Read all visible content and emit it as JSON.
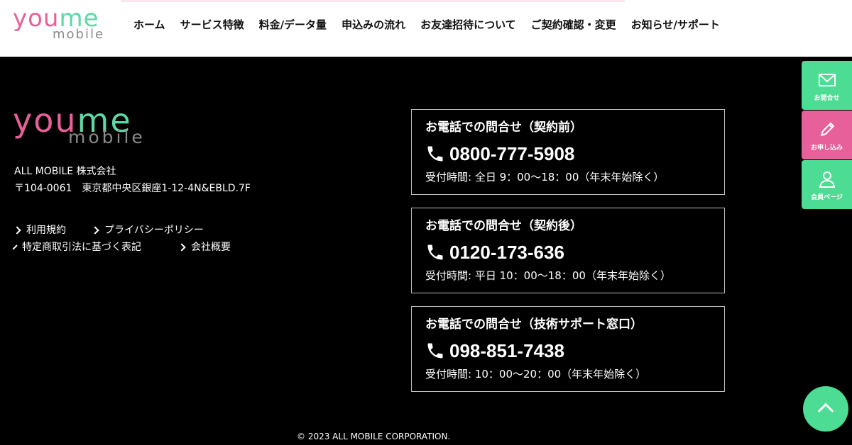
{
  "header": {
    "logo": {
      "you": "you",
      "me": "me",
      "mobile": "mobile"
    },
    "nav": [
      "ホーム",
      "サービス特徴",
      "料金/データ量",
      "申込みの流れ",
      "お友達招待について",
      "ご契約確認・変更",
      "お知らせ/サポート"
    ]
  },
  "footer": {
    "logo": {
      "you": "you",
      "me": "me",
      "mobile": "mobile"
    },
    "company_name": "ALL MOBILE 株式会社",
    "address": "〒104-0061　東京都中央区銀座1-12-4N&EBLD.7F",
    "links": [
      "利用規約",
      "プライバシーポリシー",
      "特定商取引法に基づく表記",
      "会社概要"
    ],
    "copyright": "© 2023 ALL MOBILE CORPORATION."
  },
  "contacts": [
    {
      "title": "お電話での問合せ（契約前）",
      "phone": "0800-777-5908",
      "hours": "受付時間: 全日 9：00〜18：00（年末年始除く）"
    },
    {
      "title": "お電話での問合せ（契約後）",
      "phone": "0120-173-636",
      "hours": "受付時間: 平日 10：00〜18：00（年末年始除く）"
    },
    {
      "title": "お電話での問合せ（技術サポート窓口）",
      "phone": "098-851-7438",
      "hours": "受付時間: 10：00〜20：00（年末年始除く）"
    }
  ],
  "side_tabs": [
    {
      "label": "お問合せ",
      "icon": "mail-icon",
      "color": "#4cdc93"
    },
    {
      "label": "お申し込み",
      "icon": "pencil-icon",
      "color": "#e8609a"
    },
    {
      "label": "会員ページ",
      "icon": "user-icon",
      "color": "#4cdc93"
    }
  ],
  "colors": {
    "brand_pink": "#e8609a",
    "brand_green": "#5ed8a6",
    "logo_gray": "#8b8b8b",
    "footer_bg": "#000000"
  },
  "back_to_top": {
    "icon": "chevron-up-icon"
  }
}
